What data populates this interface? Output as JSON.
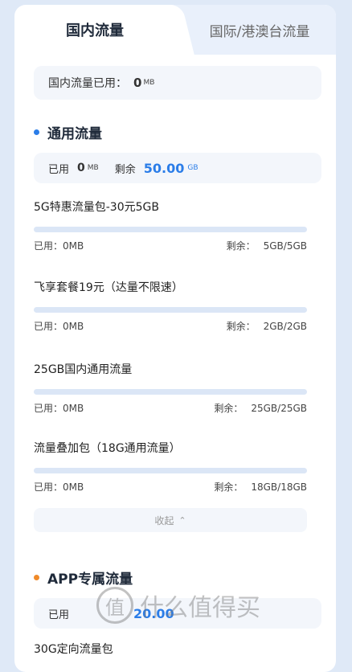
{
  "tabs": {
    "active": "国内流量",
    "inactive": "国际/港澳台流量"
  },
  "summary": {
    "label": "国内流量已用：",
    "value": "0",
    "unit": "MB"
  },
  "general": {
    "title": "通用流量",
    "used_label": "已用",
    "used_value": "0",
    "used_unit": "MB",
    "remain_label": "剩余",
    "remain_value": "50.00",
    "remain_unit": "GB",
    "packages": [
      {
        "name": "5G特惠流量包-30元5GB",
        "used_label": "已用：",
        "used": "0MB",
        "remain_label": "剩余：",
        "remain": "5GB/5GB",
        "used_fraction": 0
      },
      {
        "name": "飞享套餐19元（达量不限速）",
        "used_label": "已用：",
        "used": "0MB",
        "remain_label": "剩余：",
        "remain": "2GB/2GB",
        "used_fraction": 0
      },
      {
        "name": "25GB国内通用流量",
        "used_label": "已用：",
        "used": "0MB",
        "remain_label": "剩余：",
        "remain": "25GB/25GB",
        "used_fraction": 0
      },
      {
        "name": "流量叠加包（18G通用流量）",
        "used_label": "已用：",
        "used": "0MB",
        "remain_label": "剩余：",
        "remain": "18GB/18GB",
        "used_fraction": 0
      }
    ],
    "collapse_label": "收起",
    "collapse_icon": "chevron-up-icon"
  },
  "app": {
    "title": "APP专属流量",
    "used_label": "已用",
    "used_value": "",
    "remain_value": "20.00",
    "first_package": "30G定向流量包"
  },
  "watermark": {
    "glyph": "值",
    "text": "什么值得买"
  },
  "colors": {
    "accent": "#2b7de8",
    "section_dot_app": "#f08a2a",
    "bar_track": "#dbe6f6"
  }
}
